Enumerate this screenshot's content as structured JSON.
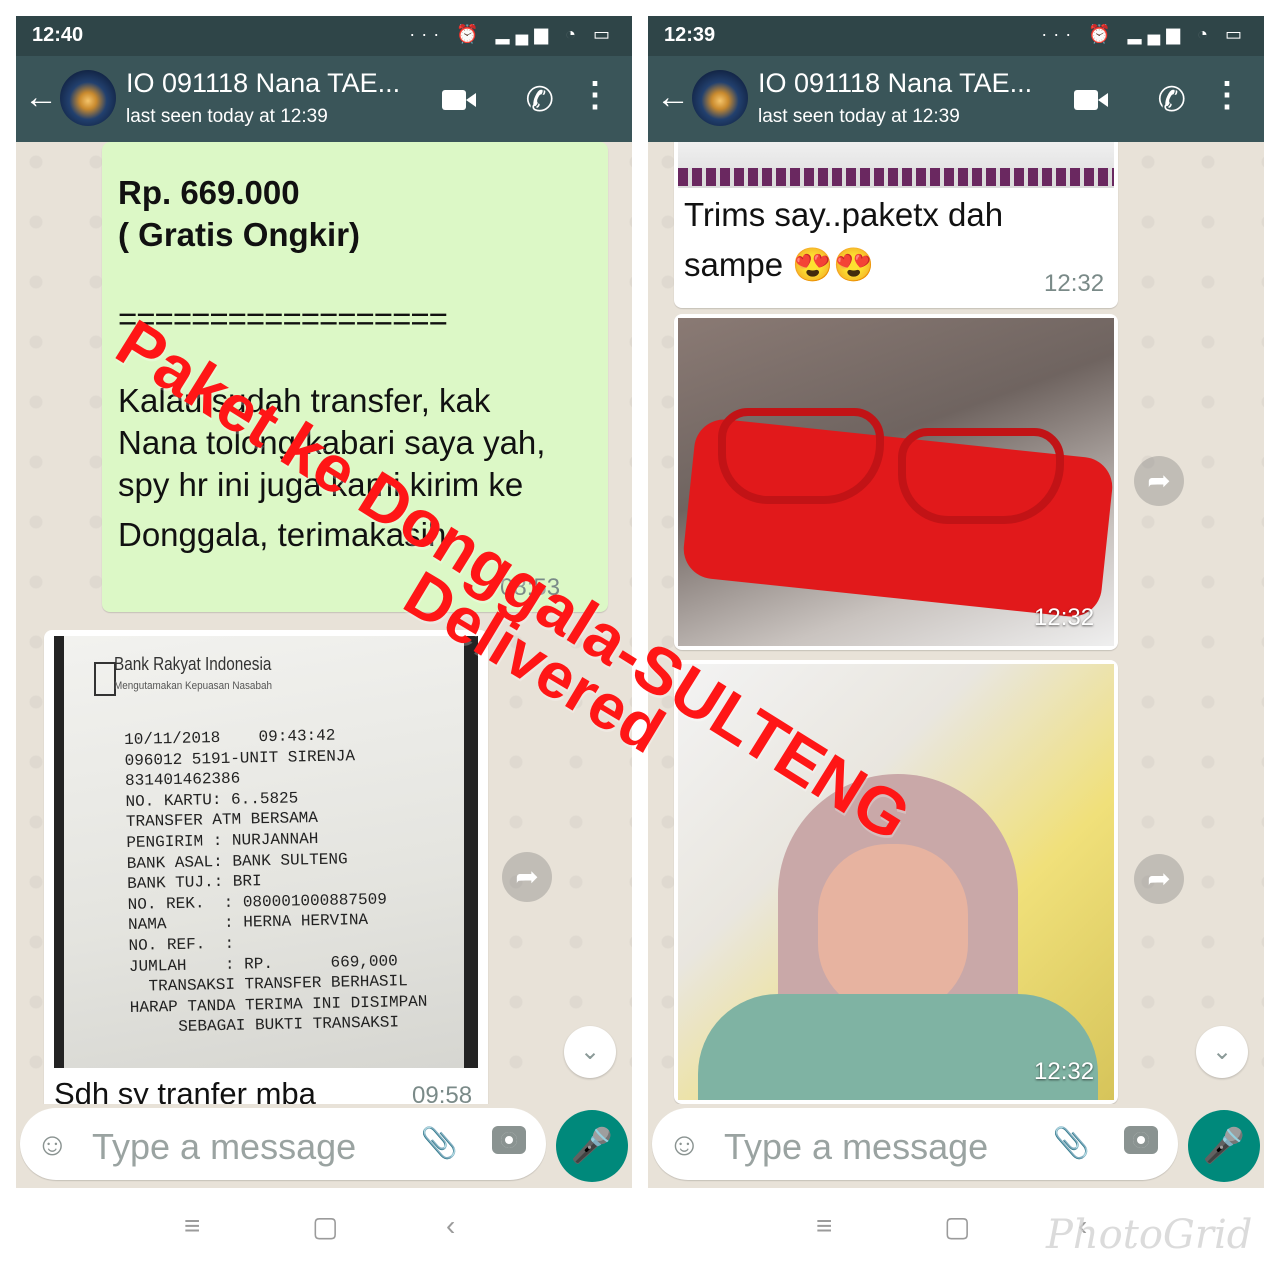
{
  "screens": [
    {
      "time": "12:40",
      "contact_name": "IO 091118 Nana TAE...",
      "last_seen": "last seen today at 12:39",
      "messages": {
        "price": "Rp. 669.000",
        "shipping": "( Gratis Ongkir)",
        "separator": "==================",
        "body_1": "Kalau sudah transfer, kak",
        "body_2": "Nana tolong kabari saya yah,",
        "body_3": "spy hr ini juga kami kirim ke",
        "body_4": "Donggala, terimakasih",
        "time_1": "08:53",
        "receipt": {
          "bank": "Bank Rakyat Indonesia",
          "tagline": "Mengutamakan Kepuasan Nasabah",
          "lines": [
            "10/11/2018    09:43:42",
            "096012 5191-UNIT SIRENJA",
            "831401462386",
            "NO. KARTU: 6..5825",
            "TRANSFER ATM BERSAMA",
            "PENGIRIM : NURJANNAH",
            "BANK ASAL: BANK SULTENG",
            "BANK TUJ.: BRI",
            "NO. REK.  : 080001000887509",
            "NAMA      : HERNA HERVINA",
            "NO. REF.  :",
            "JUMLAH    : RP.      669,000",
            "  TRANSAKSI TRANSFER BERHASIL",
            "HARAP TANDA TERIMA INI DISIMPAN",
            "     SEBAGAI BUKTI TRANSAKSI"
          ]
        },
        "caption": "Sdh sy tranfer mba",
        "time_2": "09:58"
      },
      "input_placeholder": "Type a message"
    },
    {
      "time": "12:39",
      "contact_name": "IO 091118 Nana TAE...",
      "last_seen": "last seen today at 12:39",
      "messages": {
        "thanks_1": "Trims say..paketx dah",
        "thanks_2": "sampe",
        "thanks_emoji": "😍😍",
        "time_1": "12:32",
        "time_2": "12:32",
        "time_3": "12:32"
      },
      "input_placeholder": "Type a message"
    }
  ],
  "overlay": {
    "line_1": "Paket ke Donggala-SULTENG",
    "line_2": "Delivered"
  },
  "watermark": "PhotoGrid",
  "colors": {
    "status_bar": "#2f4548",
    "app_bar": "#3a5559",
    "outgoing_bubble": "#dcf8c6",
    "mic_button": "#00897b",
    "overlay_text": "#ff1616"
  }
}
